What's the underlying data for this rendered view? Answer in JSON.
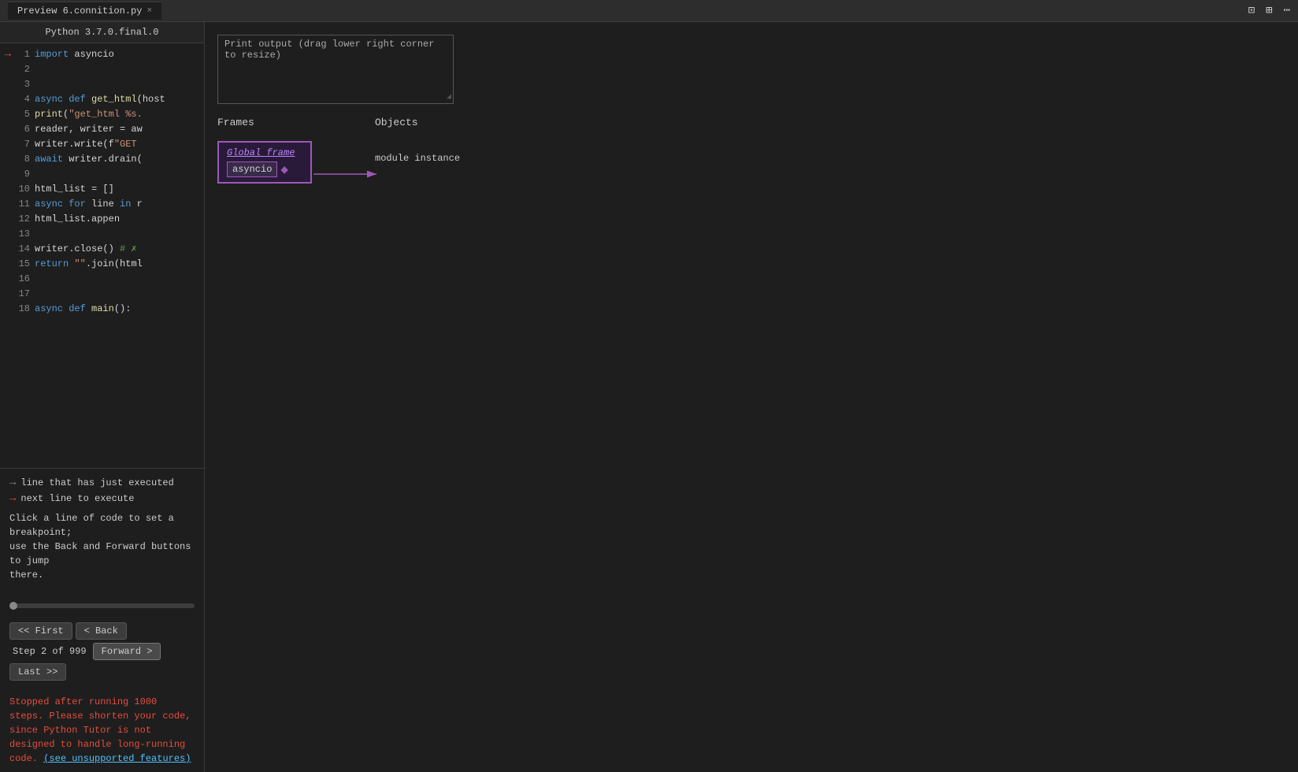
{
  "titlebar": {
    "tab_label": "Preview 6.connition.py",
    "close_icon": "×",
    "icons": [
      "⊡",
      "⊞",
      "⋯"
    ]
  },
  "python_version": "Python 3.7.0.final.0",
  "code_lines": [
    {
      "num": 1,
      "arrow": "red",
      "content": "import asyncio"
    },
    {
      "num": 2,
      "arrow": "",
      "content": ""
    },
    {
      "num": 3,
      "arrow": "",
      "content": ""
    },
    {
      "num": 4,
      "arrow": "",
      "content": "async def get_html(host"
    },
    {
      "num": 5,
      "arrow": "",
      "content": "    print(\"get_html %s."
    },
    {
      "num": 6,
      "arrow": "",
      "content": "    reader, writer = aw"
    },
    {
      "num": 7,
      "arrow": "",
      "content": "    writer.write(f\"GET"
    },
    {
      "num": 8,
      "arrow": "",
      "content": "    await writer.drain("
    },
    {
      "num": 9,
      "arrow": "",
      "content": ""
    },
    {
      "num": 10,
      "arrow": "",
      "content": "    html_list = []"
    },
    {
      "num": 11,
      "arrow": "",
      "content": "    async for line in r"
    },
    {
      "num": 12,
      "arrow": "",
      "content": "        html_list.appen"
    },
    {
      "num": 13,
      "arrow": "",
      "content": ""
    },
    {
      "num": 14,
      "arrow": "",
      "content": "    writer.close()  # ✗"
    },
    {
      "num": 15,
      "arrow": "",
      "content": "    return \"\".join(html"
    },
    {
      "num": 16,
      "arrow": "",
      "content": ""
    },
    {
      "num": 17,
      "arrow": "",
      "content": ""
    },
    {
      "num": 18,
      "arrow": "",
      "content": "async def main():"
    }
  ],
  "legend": {
    "gray_arrow_label": "line that has just executed",
    "red_arrow_label": "next line to execute",
    "instruction": "Click a line of code to set a breakpoint;\nuse the Back and Forward buttons to jump\nthere."
  },
  "navigation": {
    "first_btn": "<< First",
    "back_btn": "< Back",
    "step_info": "Step 2 of 999",
    "forward_btn": "Forward >",
    "last_btn": "Last >>"
  },
  "error_message": {
    "text": "Stopped after running 1000 steps. Please shorten your code,\nsince Python Tutor is not designed to handle long-running code.",
    "link_text": "(see\nunsupported features)"
  },
  "output_panel": {
    "header": "Print output (drag lower right corner to resize)",
    "content": ""
  },
  "frames_objects": {
    "frames_label": "Frames",
    "objects_label": "Objects",
    "global_frame_label": "Global frame",
    "frame_var": "asyncio",
    "object_label": "module instance"
  }
}
